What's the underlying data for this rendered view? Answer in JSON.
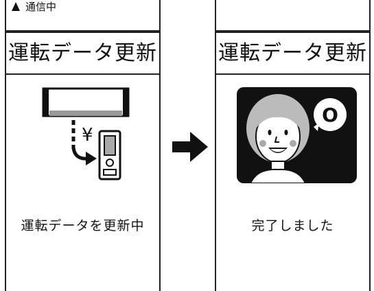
{
  "left_screen": {
    "status_text": "通信中",
    "title": "運転データ更新",
    "caption": "運転データを更新中",
    "currency_symbol": "¥"
  },
  "right_screen": {
    "title": "運転データ更新",
    "caption": "完了しました",
    "bubble_symbol": "O"
  },
  "icons": {
    "signal": "signal-icon",
    "transfer": "ac-remote-transfer-icon",
    "arrow": "arrow-right-icon",
    "complete": "smiling-person-icon"
  }
}
